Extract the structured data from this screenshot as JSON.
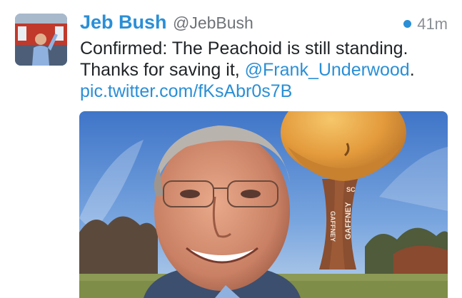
{
  "tweet": {
    "author_name": "Jeb Bush",
    "author_handle": "@JebBush",
    "timestamp": "41m",
    "text_line1": "Confirmed: The Peachoid is still standing.",
    "text_line2_prefix": "Thanks for saving it, ",
    "mention": "@Frank_Underwood",
    "text_line2_suffix": ".",
    "pic_link": "pic.twitter.com/fKsAbr0s7B"
  },
  "photo": {
    "tower_text_top": "SC",
    "tower_text_left": "GAFFNEY",
    "tower_text_right": "GAFFNEY"
  },
  "colors": {
    "accent": "#2a8fd6",
    "text": "#1f2326",
    "muted": "#6e7378"
  },
  "icons": {
    "unread_indicator": "blue-dot-icon"
  }
}
